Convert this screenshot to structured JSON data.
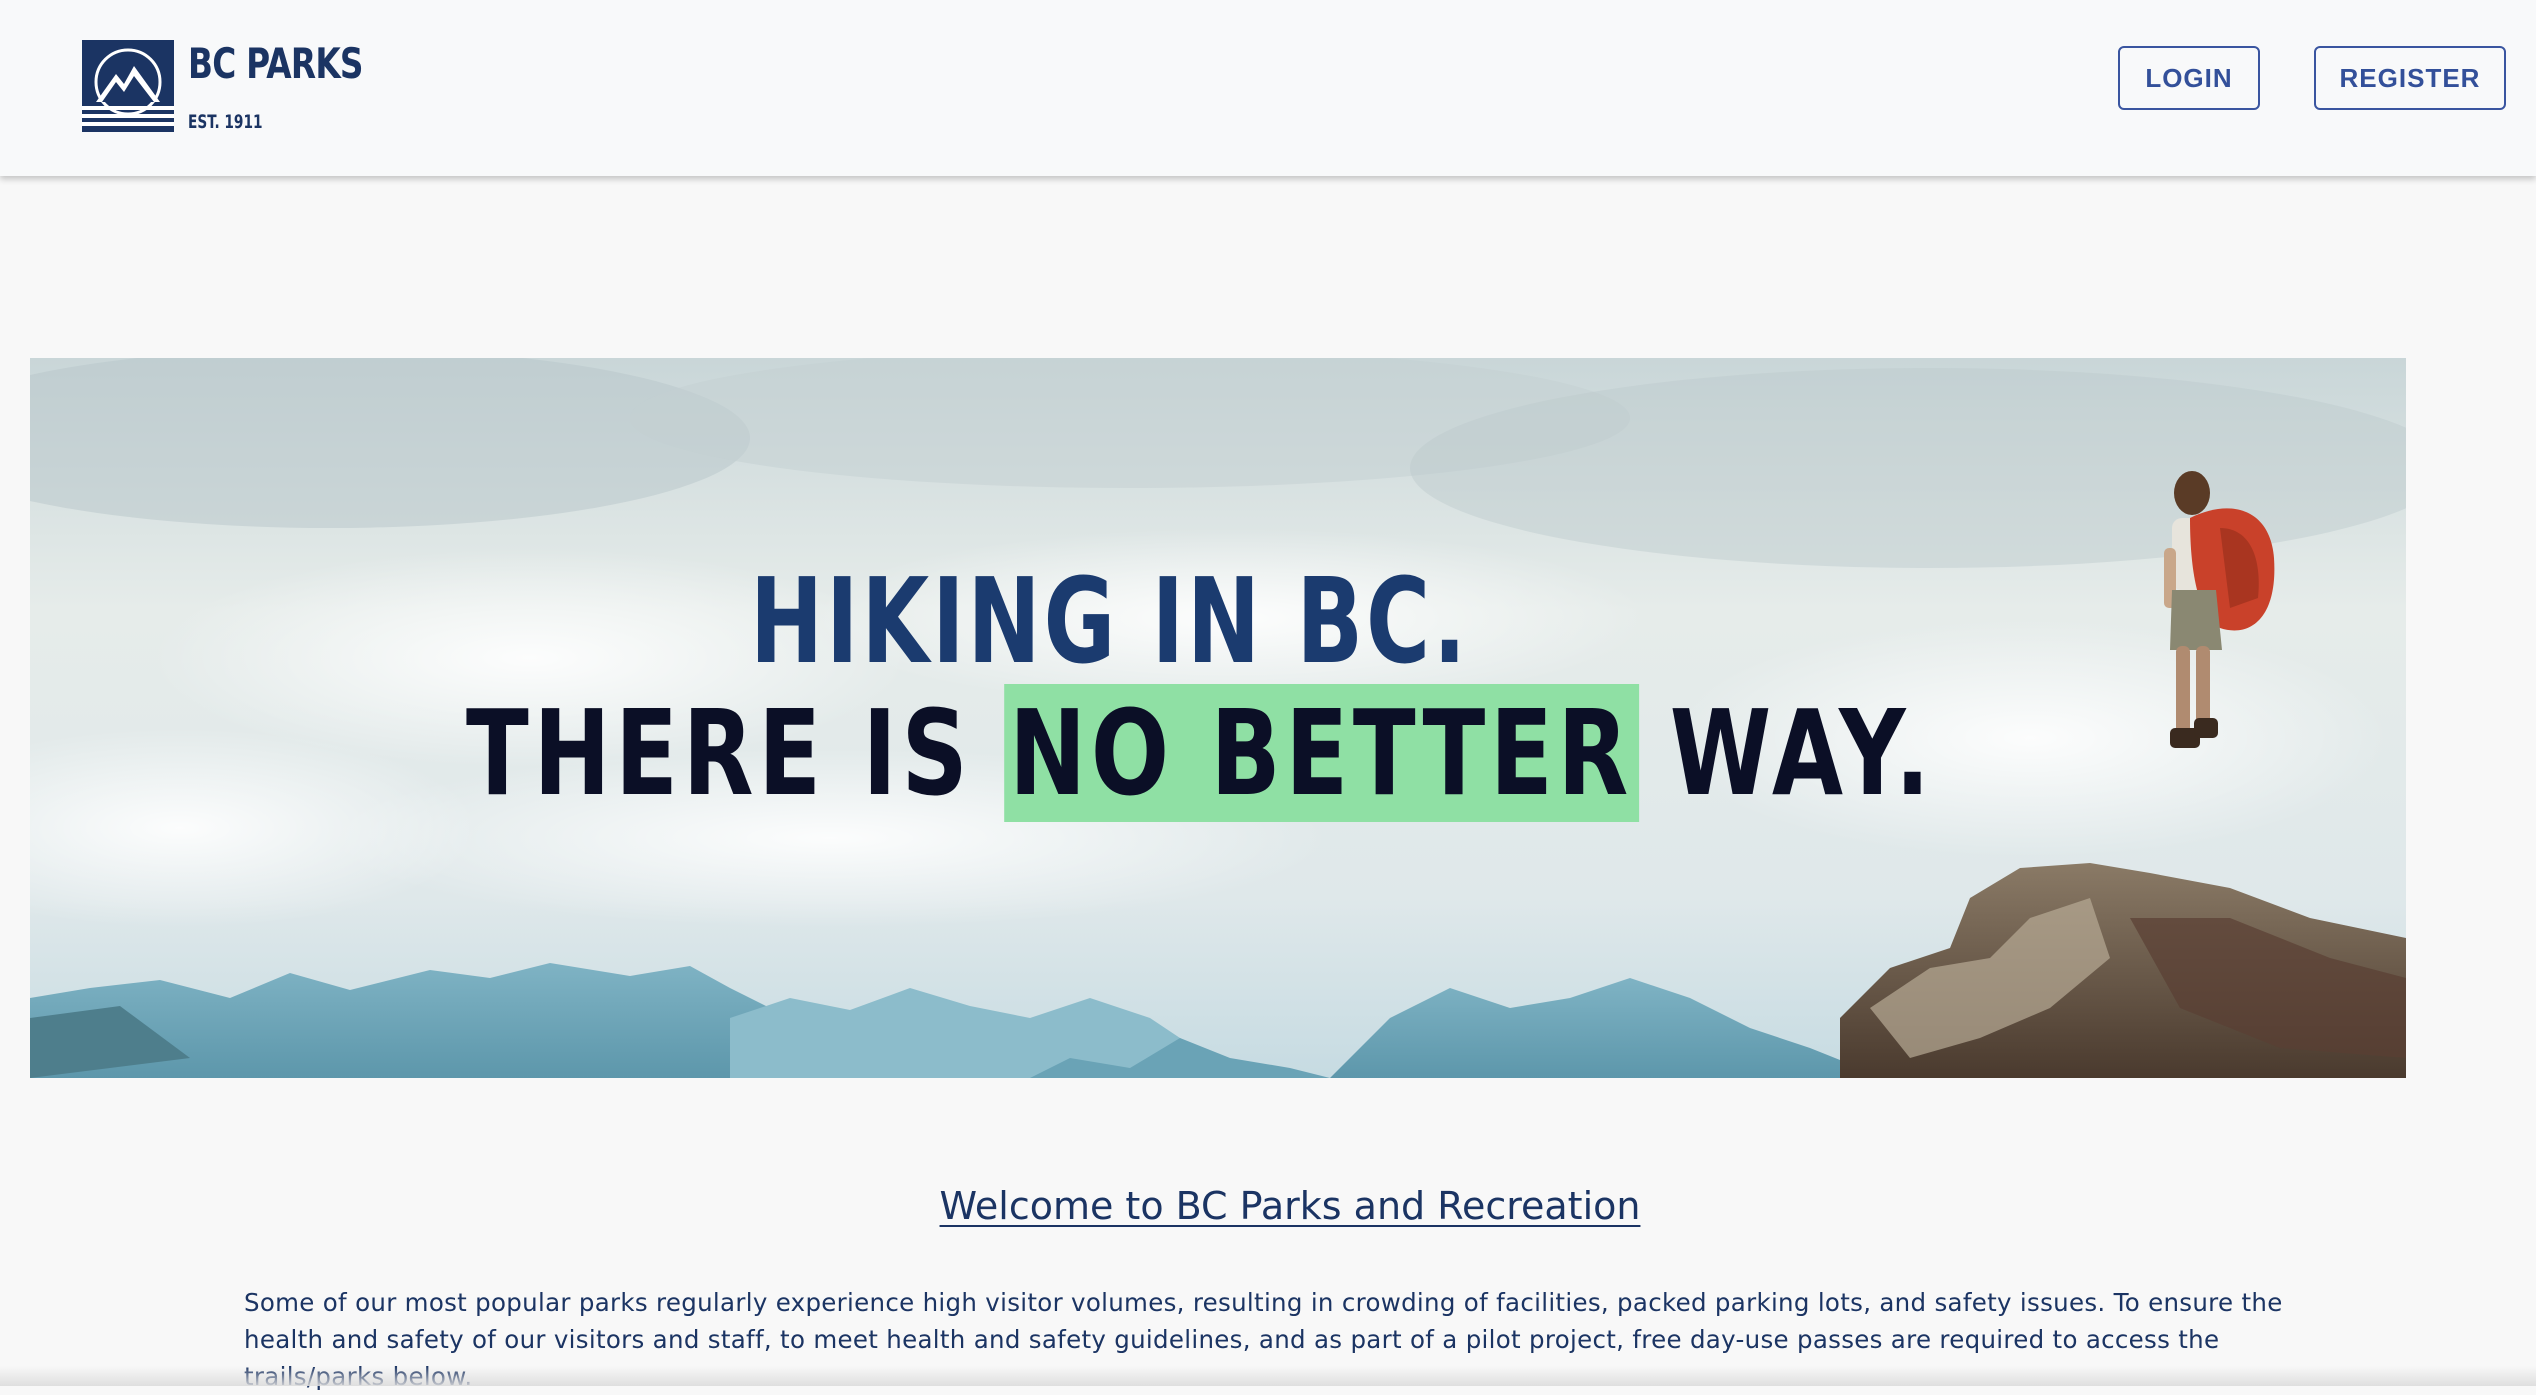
{
  "header": {
    "logo": {
      "title": "BC PARKS",
      "subtitle": "EST. 1911",
      "icon": "mountain-logo-icon"
    },
    "login_label": "LOGIN",
    "register_label": "REGISTER"
  },
  "hero": {
    "line1": "HIKING IN BC.",
    "line2_prefix": "THERE IS ",
    "line2_highlight": "NO BETTER",
    "line2_suffix": " WAY.",
    "colors": {
      "line1": "#1b3b6f",
      "line2": "#0b0f26",
      "highlight": "#8fe0a4"
    }
  },
  "main": {
    "welcome_title": "Welcome to BC Parks and Recreation",
    "intro_text": "Some of our most popular parks regularly experience high visitor volumes, resulting in crowding of facilities, packed parking lots, and safety issues. To ensure the health and safety of our visitors and staff, to meet health and safety guidelines, and as part of a pilot project, free day-use passes are required to access the trails/parks below."
  },
  "colors": {
    "brand": "#1b3463",
    "button": "#33509a",
    "background": "#f8f8f8"
  }
}
